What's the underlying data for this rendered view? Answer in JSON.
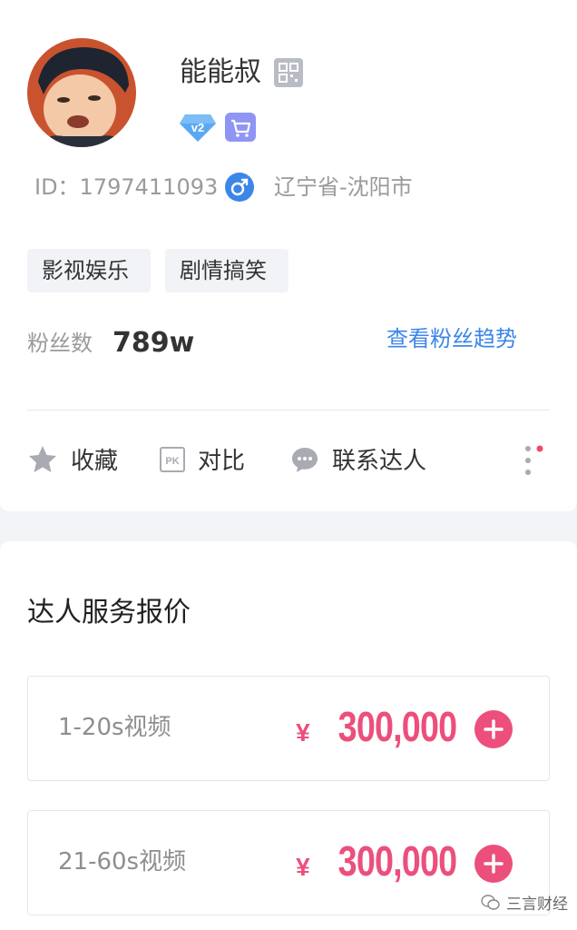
{
  "profile": {
    "name": "能能叔",
    "id_label": "ID：1797411093",
    "location": "辽宁省-沈阳市",
    "level_badge": "v2",
    "tags": [
      "影视娱乐",
      "剧情搞笑"
    ],
    "fans_label": "粉丝数",
    "fans_count": "789w",
    "fans_trend_link": "查看粉丝趋势"
  },
  "actions": {
    "favorite": "收藏",
    "compare": "对比",
    "compare_icon_text": "PK",
    "contact": "联系达人"
  },
  "pricing": {
    "title": "达人服务报价",
    "items": [
      {
        "name": "1-20s视频",
        "currency": "¥",
        "price": "300,000"
      },
      {
        "name": "21-60s视频",
        "currency": "¥",
        "price": "300,000"
      }
    ]
  },
  "watermark": {
    "text": "三言财经"
  },
  "colors": {
    "accent_blue": "#3c86e8",
    "price_pink": "#ec4f7c",
    "cart_purple": "#8f95f5",
    "gender_blue": "#3c86e8"
  },
  "icons": {
    "qr": "qrcode-icon",
    "level": "v2-diamond-icon",
    "cart": "shopping-cart-icon",
    "gender": "male-icon",
    "favorite": "star-icon",
    "compare": "pk-icon",
    "contact": "chat-bubble-icon",
    "more": "more-vertical-icon",
    "add": "plus-icon"
  }
}
